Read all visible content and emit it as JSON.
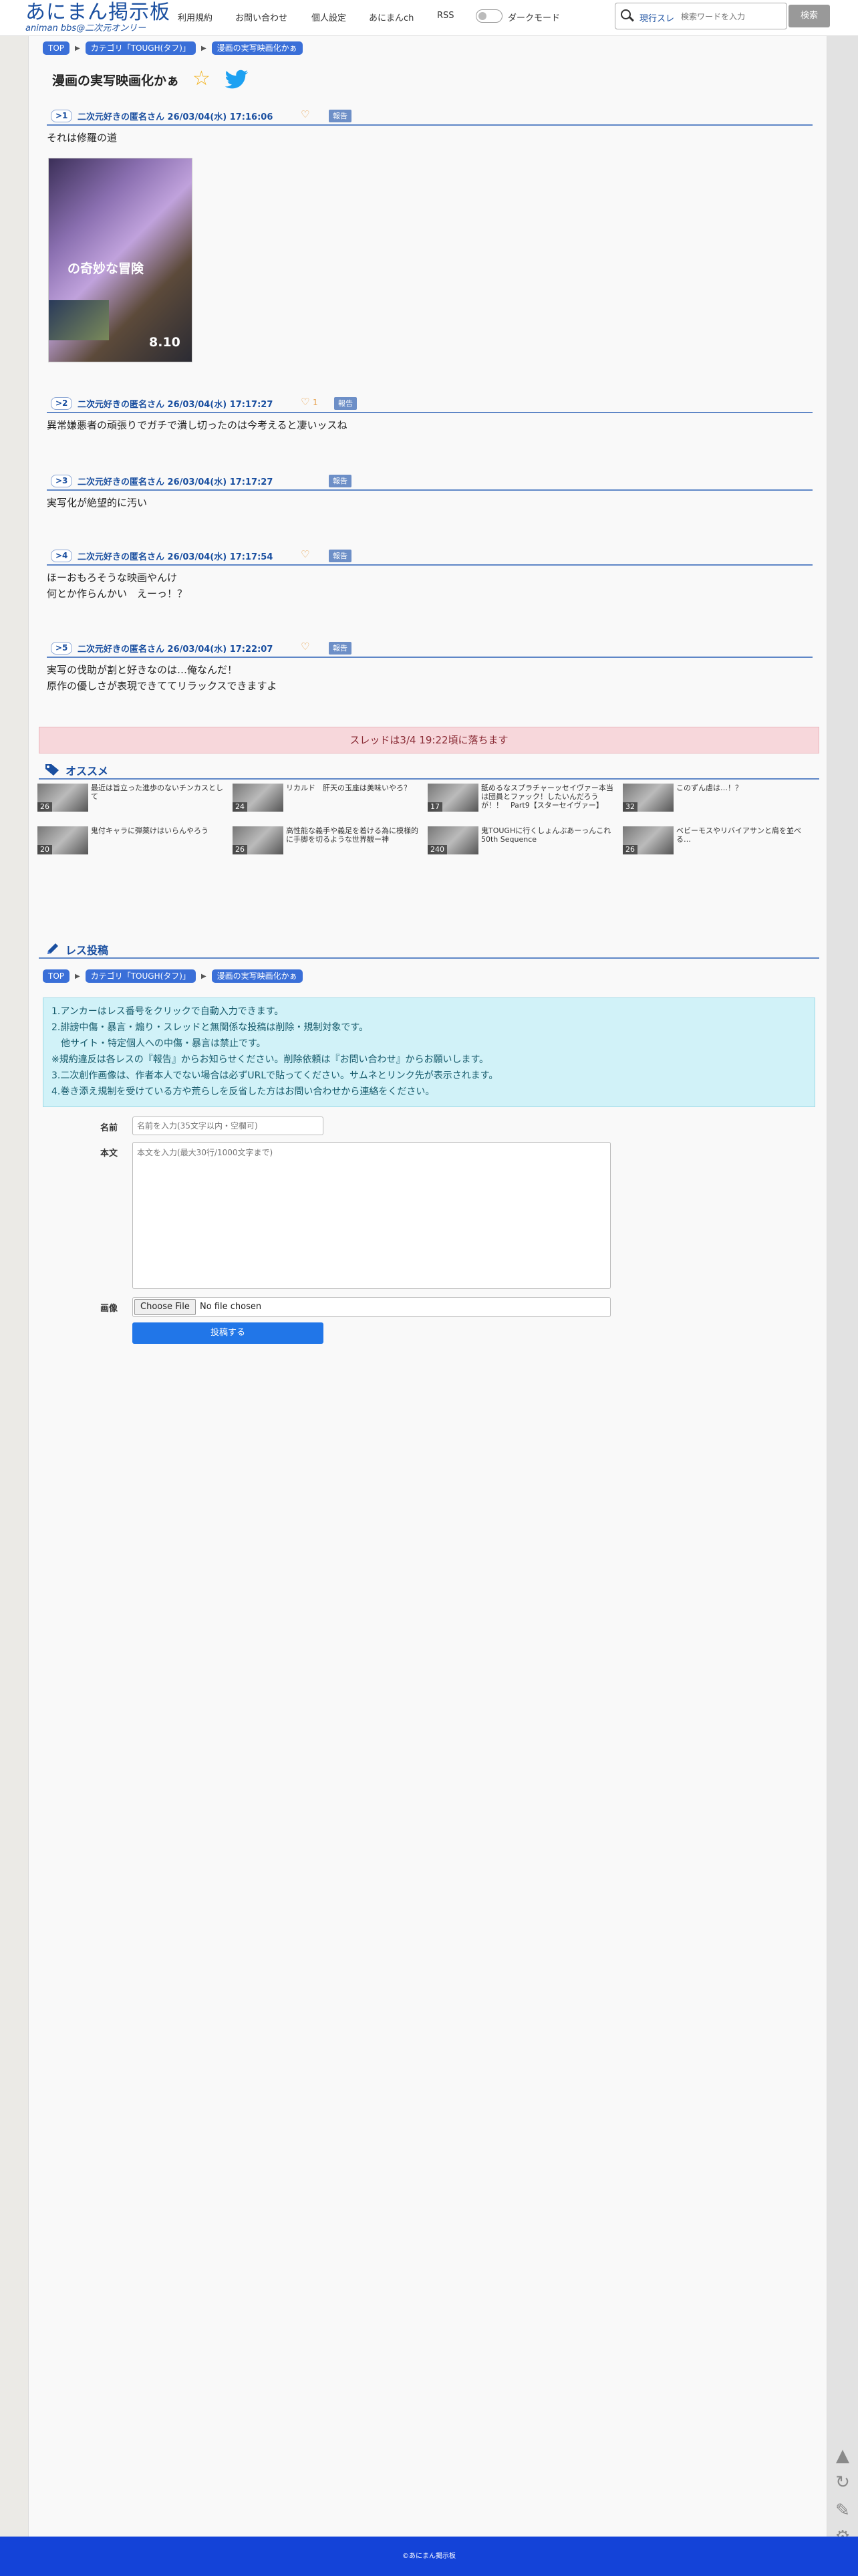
{
  "header": {
    "logo_title": "あにまん掲示板",
    "logo_sub": "animan bbs@二次元オンリー",
    "nav": [
      "利用規約",
      "お問い合わせ",
      "個人設定",
      "あにまんch",
      "RSS"
    ],
    "dark_mode_label": "ダークモード",
    "current_threads": "現行スレ",
    "search_placeholder": "検索ワードを入力",
    "search_button": "検索"
  },
  "breadcrumb": [
    "TOP",
    "カテゴリ「TOUGH(タフ)」",
    "漫画の実写映画化かぁ"
  ],
  "thread_title": "漫画の実写映画化かぁ",
  "report_label": "報告",
  "posts": [
    {
      "num": ">1",
      "meta": "二次元好きの匿名さん 26/03/04(水) 17:16:06",
      "likes": "",
      "lines": [
        "それは修羅の道"
      ]
    },
    {
      "num": ">2",
      "meta": "二次元好きの匿名さん 26/03/04(水) 17:17:27",
      "likes": "1",
      "lines": [
        "異常嫌悪者の頑張りでガチで潰し切ったのは今考えると凄いッスね"
      ]
    },
    {
      "num": ">3",
      "meta": "二次元好きの匿名さん 26/03/04(水) 17:17:27",
      "likes": "",
      "lines": [
        "実写化が絶望的に汚い"
      ]
    },
    {
      "num": ">4",
      "meta": "二次元好きの匿名さん 26/03/04(水) 17:17:54",
      "likes": "",
      "lines": [
        "ほーおもろそうな映画やんけ",
        "何とか作らんかい　えーっ！？"
      ]
    },
    {
      "num": ">5",
      "meta": "二次元好きの匿名さん 26/03/04(水) 17:22:07",
      "likes": "",
      "lines": [
        "実写の伐助が割と好きなのは…俺なんだ！",
        "原作の優しさが表現できててリラックスできますよ"
      ]
    }
  ],
  "image": {
    "caption_main": "の奇妙な冒険",
    "caption_date": "8.10"
  },
  "drop_notice": "スレッドは3/4 19:22頃に落ちます",
  "recommend": {
    "title": "オススメ",
    "items": [
      {
        "count": "26",
        "title": "最近は旨立った進歩のないチンカスとして"
      },
      {
        "count": "24",
        "title": "リカルド　肝天の玉座は美味いやろ？"
      },
      {
        "count": "17",
        "title": "舐めるなスプラチャーッセイヴァー本当は団員とファック！したいんだろうが！！　Part9【スターセイヴァー】"
      },
      {
        "count": "32",
        "title": "このずん虐は…！？"
      },
      {
        "count": "20",
        "title": "鬼付キャラに弾薬けはいらんやろう"
      },
      {
        "count": "26",
        "title": "高性能な義手や義足を着ける為に模様的に手脚を切るような世界観ー神"
      },
      {
        "count": "240",
        "title": "鬼TOUGHに行くしょんぶあーっんこれ　50th Sequence"
      },
      {
        "count": "26",
        "title": "ベビーモスやリバイアサンと肩を並べる…"
      }
    ]
  },
  "reply_form": {
    "title": "レス投稿",
    "rules": [
      "1.アンカーはレス番号をクリックで自動入力できます。",
      "2.誹謗中傷・暴言・煽り・スレッドと無関係な投稿は削除・規制対象です。",
      "　他サイト・特定個人への中傷・暴言は禁止です。",
      "※規約違反は各レスの『報告』からお知らせください。削除依頼は『お問い合わせ』からお願いします。",
      "3.二次創作画像は、作者本人でない場合は必ずURLで貼ってください。サムネとリンク先が表示されます。",
      "4.巻き添え規制を受けている方や荒らしを反省した方はお問い合わせから連絡をください。"
    ],
    "name_label": "名前",
    "name_placeholder": "名前を入力(35文字以内・空欄可)",
    "body_label": "本文",
    "body_placeholder": "本文を入力(最大30行/1000文字まで)",
    "image_label": "画像",
    "file_button": "Choose File",
    "file_status": "No file chosen",
    "submit": "投稿する"
  },
  "footer": "©あにまん掲示板"
}
